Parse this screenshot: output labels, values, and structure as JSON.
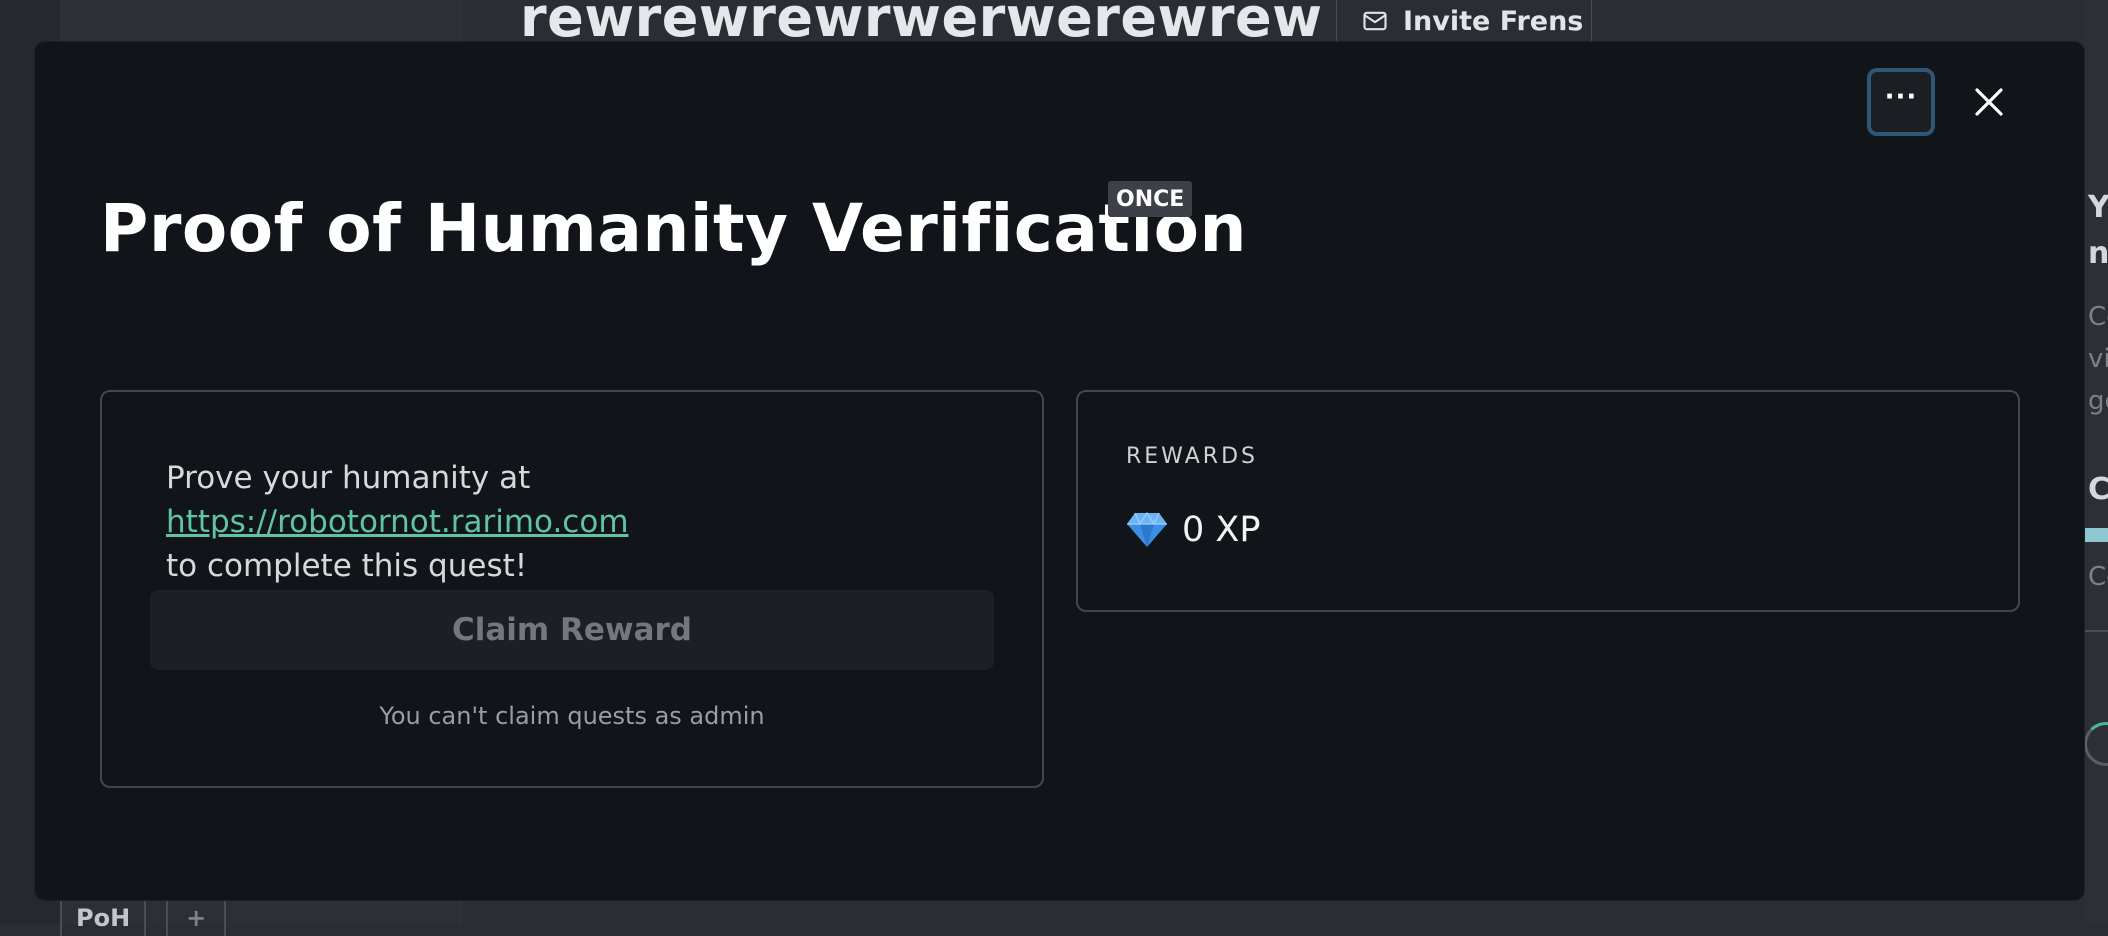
{
  "background": {
    "header_title": "rewrewrewrwerwerewrew",
    "invite_button": "Invite Frens",
    "right_panel_fragments": [
      "Yo",
      "nie",
      "Co",
      "vis",
      "ge",
      "Co",
      "Co"
    ],
    "tabs": [
      "PoH",
      "+"
    ]
  },
  "modal": {
    "title": "Proof of Humanity Verification",
    "badge": "ONCE",
    "more_label": "···",
    "quest": {
      "description_prefix": "Prove your humanity at",
      "link": " https://robotornot.rarimo.com ",
      "description_suffix": "to complete this quest!",
      "claim_button": "Claim Reward",
      "admin_note": "You can't claim quests as admin"
    },
    "rewards": {
      "label": "REWARDS",
      "xp": "0 XP",
      "icon": "diamond-icon"
    }
  },
  "colors": {
    "link": "#5fc3a4",
    "focus_ring": "#2e5678",
    "modal_bg": "#111418",
    "gem": "#3a8fe6"
  }
}
